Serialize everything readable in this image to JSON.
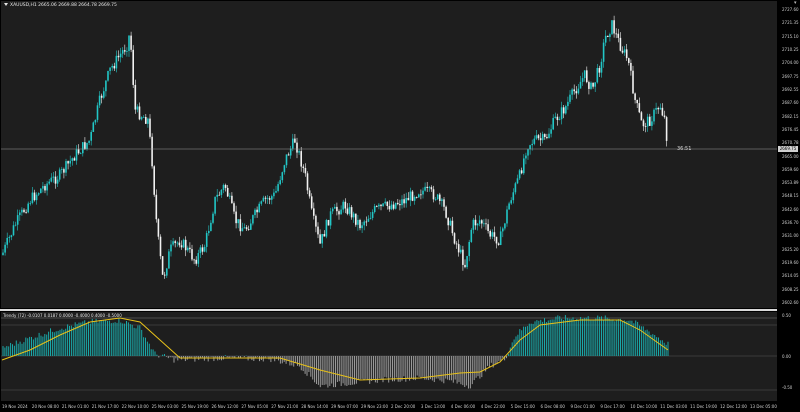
{
  "symbol_label": "XAUUSD,H1  2665.06 2669.88 2664.78 2669.75",
  "indicator_label": "Trendy (72) -0.0107 0.0187 0.0000 -0.4000 0.4000 -0.5000",
  "price_axis": [
    "2727.60",
    "2721.35",
    "2715.10",
    "2710.25",
    "2704.00",
    "2697.75",
    "2692.55",
    "2687.60",
    "2682.15",
    "2676.45",
    "2670.78",
    "2665.00",
    "2659.60",
    "2653.89",
    "2648.15",
    "2642.60",
    "2636.70",
    "2631.00",
    "2625.20",
    "2619.60",
    "2614.05",
    "2608.25",
    "2602.60"
  ],
  "current_price": "2669.75",
  "timer": "36:51",
  "indicator_axis": [
    "0.50",
    "0.00",
    "-0.50"
  ],
  "time_axis": [
    "19 Nov 2024",
    "20 Nov 08:00",
    "21 Nov 01:00",
    "21 Nov 17:00",
    "22 Nov 10:00",
    "25 Nov 03:00",
    "25 Nov 19:00",
    "26 Nov 12:00",
    "27 Nov 05:00",
    "27 Nov 21:00",
    "28 Nov 14:00",
    "29 Nov 07:00",
    "29 Nov 23:00",
    "2 Dec 20:00",
    "3 Dec 13:00",
    "4 Dec 06:00",
    "4 Dec 22:00",
    "5 Dec 15:00",
    "6 Dec 08:00",
    "9 Dec 01:00",
    "9 Dec 17:00",
    "10 Dec 10:00",
    "11 Dec 03:00",
    "11 Dec 19:00",
    "12 Dec 12:00",
    "13 Dec 05:00"
  ],
  "colors": {
    "background": "#1e1e1e",
    "bull": "#22c7c7",
    "bear": "#f2f2f2",
    "hist_pos": "#1aa8a8",
    "hist_neg": "#9a9a9a",
    "signal": "#e8c21a"
  },
  "icons": {
    "symbol_menu": "triangle-down-icon",
    "scroll": "arrow-icon"
  }
}
